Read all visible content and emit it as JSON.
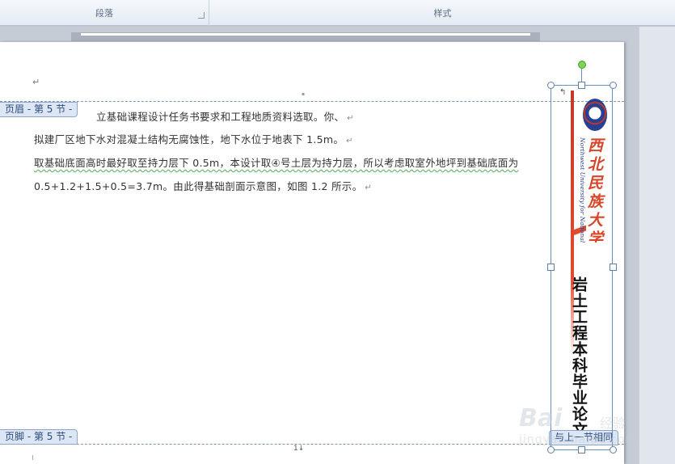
{
  "ribbon": {
    "paragraph_label": "段落",
    "styles_label": "样式",
    "launcher_glyph": "↘"
  },
  "document": {
    "header_tag": "页眉 - 第 5 节 -",
    "footer_tag": "页脚 - 第 5 节 -",
    "same_as_previous": "与上一节相同",
    "paragraph_mark": "↵",
    "lines": [
      "立基础课程设计任务书要求和工程地质资料选取。你、",
      "拟建厂区地下水对混凝土结构无腐蚀性，地下水位于地表下 1.5m。",
      "取基础底面高时最好取至持力层下 0.5m，本设计取④号土层为持力层，所以考虑取室外地坪到基础底面为",
      "0.5+1.2+1.5+0.5=3.7m。由此得基础剖面示意图，如图 1.2 所示。"
    ],
    "footer_page_mark": "1↓"
  },
  "textbox": {
    "university_cn": "西北民族大学",
    "university_en": "Northwest University for Nationalities",
    "thesis_title": "岩土工程本科毕业论文（设计）",
    "anchor_glyph": "↰"
  },
  "watermark": {
    "brand": "Bai",
    "brand_cn": "经验",
    "sub": "jingyan.baidu.com"
  }
}
